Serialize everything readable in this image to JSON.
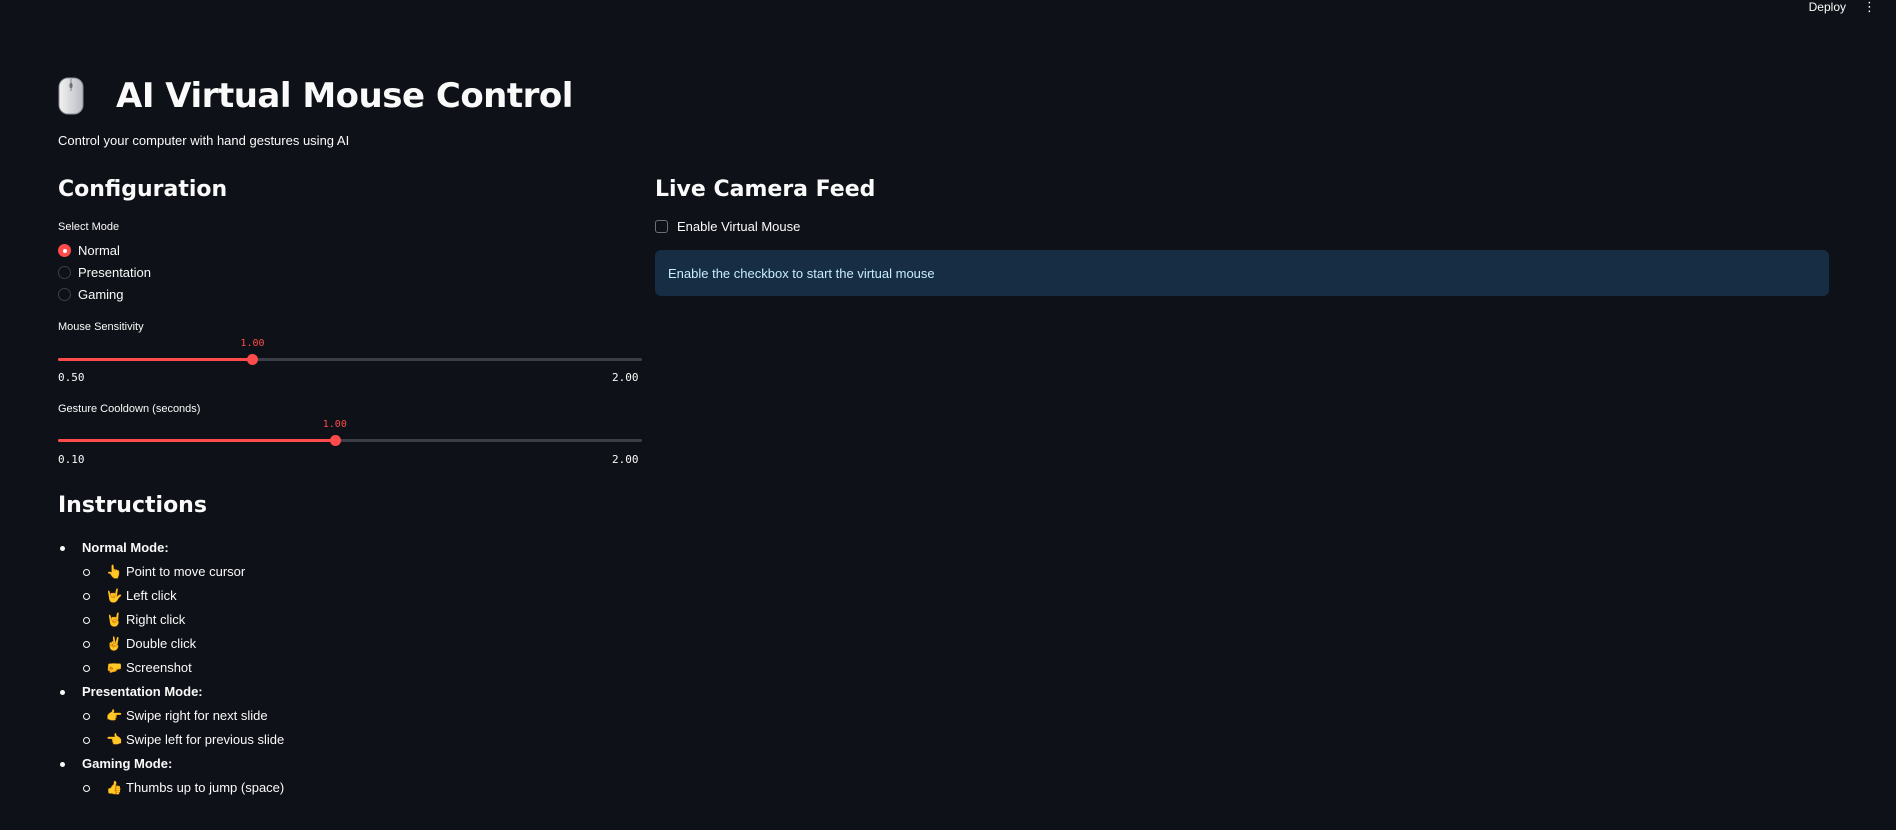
{
  "header": {
    "deploy_label": "Deploy",
    "menu_icon": "vertical-ellipsis-icon"
  },
  "app": {
    "title_icon": "computer-mouse-icon",
    "title": "AI Virtual Mouse Control",
    "subtitle": "Control your computer with hand gestures using AI"
  },
  "config": {
    "heading": "Configuration",
    "mode_label": "Select Mode",
    "modes": [
      {
        "label": "Normal",
        "selected": true
      },
      {
        "label": "Presentation",
        "selected": false
      },
      {
        "label": "Gaming",
        "selected": false
      }
    ],
    "sensitivity": {
      "label": "Mouse Sensitivity",
      "value": "1.00",
      "min": "0.50",
      "max": "2.00",
      "fraction": 0.333
    },
    "cooldown": {
      "label": "Gesture Cooldown (seconds)",
      "value": "1.00",
      "min": "0.10",
      "max": "2.00",
      "fraction": 0.474
    }
  },
  "instructions": {
    "heading": "Instructions",
    "groups": [
      {
        "title": "Normal Mode:",
        "items": [
          {
            "emoji": "👆",
            "text": "Point to move cursor"
          },
          {
            "emoji": "🤟",
            "text": "Left click"
          },
          {
            "emoji": "🤘",
            "text": "Right click"
          },
          {
            "emoji": "✌️",
            "text": "Double click"
          },
          {
            "emoji": "🤛",
            "text": "Screenshot"
          }
        ]
      },
      {
        "title": "Presentation Mode:",
        "items": [
          {
            "emoji": "👉",
            "text": "Swipe right for next slide"
          },
          {
            "emoji": "👈",
            "text": "Swipe left for previous slide"
          }
        ]
      },
      {
        "title": "Gaming Mode:",
        "items": [
          {
            "emoji": "👍",
            "text": "Thumbs up to jump (space)"
          }
        ]
      }
    ]
  },
  "camera": {
    "heading": "Live Camera Feed",
    "checkbox_label": "Enable Virtual Mouse",
    "checked": false,
    "info_text": "Enable the checkbox to start the virtual mouse"
  },
  "colors": {
    "background": "#0e1117",
    "accent": "#ff4b4b",
    "info_bg": "#172d43",
    "info_text": "#c7ebff"
  }
}
